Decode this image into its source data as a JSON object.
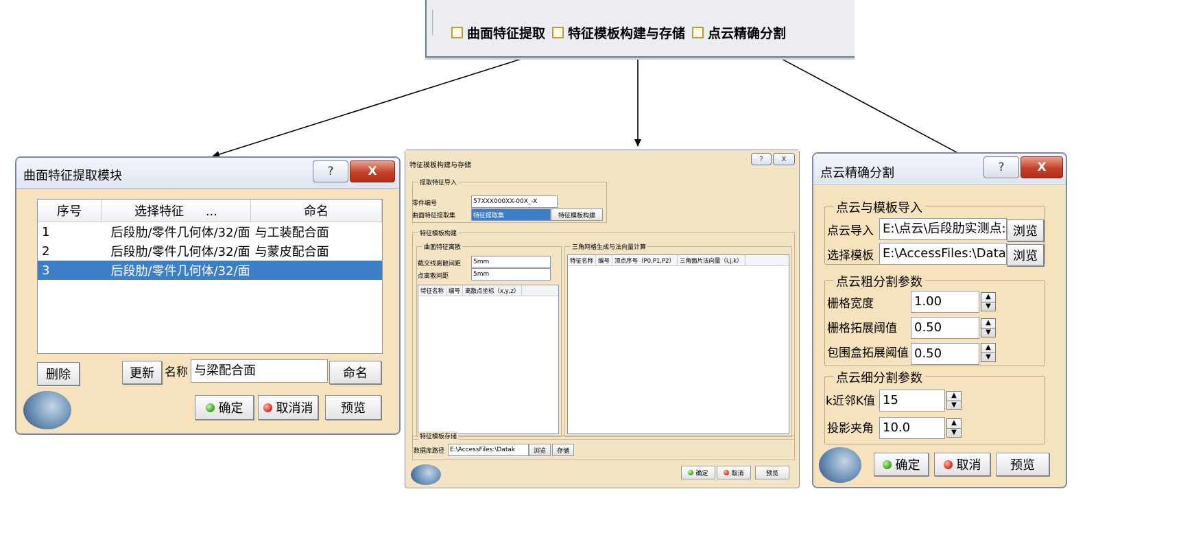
{
  "toolbar": {
    "items": [
      "曲面特征提取",
      "特征模板构建与存储",
      "点云精确分割"
    ]
  },
  "left_dialog": {
    "title": "曲面特征提取模块",
    "help_label": "?",
    "close_label": "X",
    "columns": [
      "序号",
      "选择特征",
      "...",
      "命名"
    ],
    "rows": [
      {
        "index": "1",
        "feature": "后段肋/零件几何体/32/面",
        "name": "与工装配合面"
      },
      {
        "index": "2",
        "feature": "后段肋/零件几何体/32/面",
        "name": "与蒙皮配合面"
      },
      {
        "index": "3",
        "feature": "后段肋/零件几何体/32/面",
        "name": ""
      }
    ],
    "delete_label": "删除",
    "update_label": "更新",
    "name_label": "名称",
    "name_value": "与梁配合面",
    "rename_label": "命名",
    "ok_label": "确定",
    "cancel_label": "取消消",
    "preview_label": "预览"
  },
  "mid_dialog": {
    "title": "特征模板构建与存储",
    "help_label": "?",
    "close_label": "X",
    "import_group": "提取特征导入",
    "part_no_label": "零件编号",
    "part_no_value": "57XXX000XX-00X_-X",
    "surface_label": "曲面特征提取集",
    "surface_value": "特征提取集",
    "build_button": "特征模板构建",
    "build_group": "特征模板构建",
    "discrete_group": "曲面特征离散",
    "line_spacing_label": "截交线离散间距",
    "line_spacing_value": "5mm",
    "point_spacing_label": "点离散间距",
    "point_spacing_value": "5mm",
    "discrete_columns": [
      "特征名称",
      "编号",
      "离散点坐标（x,y,z）"
    ],
    "mesh_group": "三角网格生成与法向量计算",
    "mesh_columns": [
      "特征名称",
      "编号",
      "顶点序号（P0,P1,P2）",
      "三角面片法向量（i,j,k）"
    ],
    "store_group": "特征模板存储",
    "db_path_label": "数据库路径",
    "db_path_value": "E:\\AccessFiles:\\Datak",
    "browse_label": "浏览",
    "save_label": "存储",
    "ok_label": "确定",
    "cancel_label": "取消",
    "preview_label": "预览"
  },
  "right_dialog": {
    "title": "点云精确分割",
    "help_label": "?",
    "close_label": "X",
    "import_group": "点云与模板导入",
    "cloud_label": "点云导入",
    "cloud_value": "E:\\点云\\后段肋实测点:",
    "template_label": "选择模板",
    "template_value": "E:\\AccessFiles:\\Datak",
    "browse_label": "浏览",
    "coarse_group": "点云粗分割参数",
    "grid_width_label": "栅格宽度",
    "grid_width_value": "1.00",
    "grid_expand_label": "栅格拓展阈值",
    "grid_expand_value": "0.50",
    "bbox_expand_label": "包围盒拓展阈值",
    "bbox_expand_value": "0.50",
    "fine_group": "点云细分割参数",
    "knn_label": "k近邻K值",
    "knn_value": "15",
    "angle_label": "投影夹角",
    "angle_value": "10.0",
    "ok_label": "确定",
    "cancel_label": "取消",
    "preview_label": "预览"
  },
  "colors": {
    "dialog_bg": "#f6e3bd",
    "selection": "#3c7fc6",
    "close_red": "#c4412b"
  }
}
